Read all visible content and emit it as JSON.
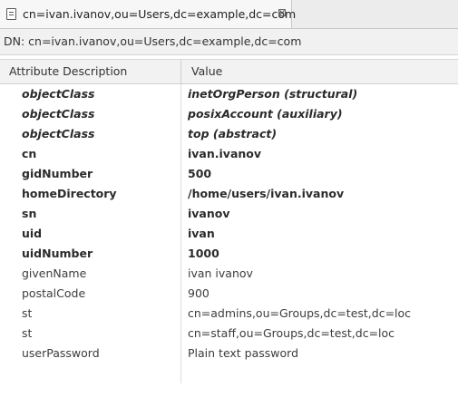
{
  "tab": {
    "title": "cn=ivan.ivanov,ou=Users,dc=example,dc=com"
  },
  "dn_line": "DN: cn=ivan.ivanov,ou=Users,dc=example,dc=com",
  "columns": {
    "attribute": "Attribute Description",
    "value": "Value"
  },
  "attributes": [
    {
      "name": "objectClass",
      "value": "inetOrgPerson (structural)",
      "style": "objectclass"
    },
    {
      "name": "objectClass",
      "value": "posixAccount (auxiliary)",
      "style": "objectclass"
    },
    {
      "name": "objectClass",
      "value": "top (abstract)",
      "style": "objectclass"
    },
    {
      "name": "cn",
      "value": "ivan.ivanov",
      "style": "required"
    },
    {
      "name": "gidNumber",
      "value": "500",
      "style": "required"
    },
    {
      "name": "homeDirectory",
      "value": "/home/users/ivan.ivanov",
      "style": "required"
    },
    {
      "name": "sn",
      "value": "ivanov",
      "style": "required"
    },
    {
      "name": "uid",
      "value": "ivan",
      "style": "required"
    },
    {
      "name": "uidNumber",
      "value": "1000",
      "style": "required"
    },
    {
      "name": "givenName",
      "value": "ivan ivanov",
      "style": "optional"
    },
    {
      "name": "postalCode",
      "value": "900",
      "style": "optional"
    },
    {
      "name": "st",
      "value": "cn=admins,ou=Groups,dc=test,dc=loc",
      "style": "optional"
    },
    {
      "name": "st",
      "value": "cn=staff,ou=Groups,dc=test,dc=loc",
      "style": "optional"
    },
    {
      "name": "userPassword",
      "value": "Plain text password",
      "style": "optional"
    }
  ]
}
